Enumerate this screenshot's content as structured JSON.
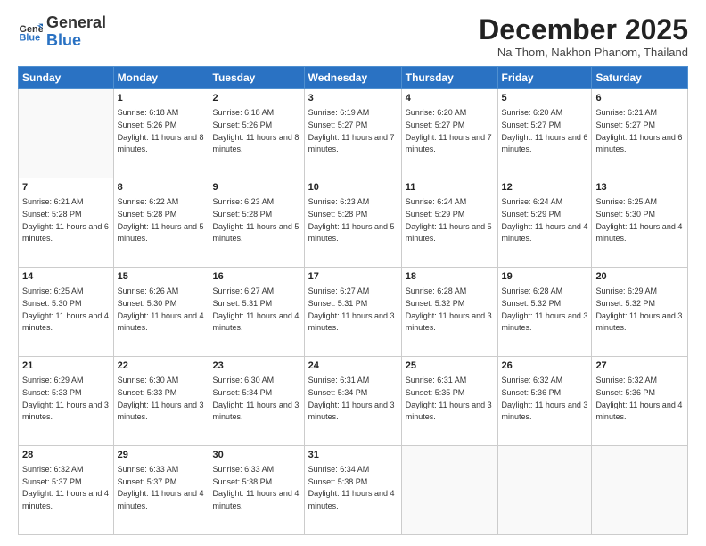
{
  "logo": {
    "text_general": "General",
    "text_blue": "Blue"
  },
  "header": {
    "month": "December 2025",
    "location": "Na Thom, Nakhon Phanom, Thailand"
  },
  "days_of_week": [
    "Sunday",
    "Monday",
    "Tuesday",
    "Wednesday",
    "Thursday",
    "Friday",
    "Saturday"
  ],
  "weeks": [
    [
      {
        "day": "",
        "sunrise": "",
        "sunset": "",
        "daylight": ""
      },
      {
        "day": "1",
        "sunrise": "Sunrise: 6:18 AM",
        "sunset": "Sunset: 5:26 PM",
        "daylight": "Daylight: 11 hours and 8 minutes."
      },
      {
        "day": "2",
        "sunrise": "Sunrise: 6:18 AM",
        "sunset": "Sunset: 5:26 PM",
        "daylight": "Daylight: 11 hours and 8 minutes."
      },
      {
        "day": "3",
        "sunrise": "Sunrise: 6:19 AM",
        "sunset": "Sunset: 5:27 PM",
        "daylight": "Daylight: 11 hours and 7 minutes."
      },
      {
        "day": "4",
        "sunrise": "Sunrise: 6:20 AM",
        "sunset": "Sunset: 5:27 PM",
        "daylight": "Daylight: 11 hours and 7 minutes."
      },
      {
        "day": "5",
        "sunrise": "Sunrise: 6:20 AM",
        "sunset": "Sunset: 5:27 PM",
        "daylight": "Daylight: 11 hours and 6 minutes."
      },
      {
        "day": "6",
        "sunrise": "Sunrise: 6:21 AM",
        "sunset": "Sunset: 5:27 PM",
        "daylight": "Daylight: 11 hours and 6 minutes."
      }
    ],
    [
      {
        "day": "7",
        "sunrise": "Sunrise: 6:21 AM",
        "sunset": "Sunset: 5:28 PM",
        "daylight": "Daylight: 11 hours and 6 minutes."
      },
      {
        "day": "8",
        "sunrise": "Sunrise: 6:22 AM",
        "sunset": "Sunset: 5:28 PM",
        "daylight": "Daylight: 11 hours and 5 minutes."
      },
      {
        "day": "9",
        "sunrise": "Sunrise: 6:23 AM",
        "sunset": "Sunset: 5:28 PM",
        "daylight": "Daylight: 11 hours and 5 minutes."
      },
      {
        "day": "10",
        "sunrise": "Sunrise: 6:23 AM",
        "sunset": "Sunset: 5:28 PM",
        "daylight": "Daylight: 11 hours and 5 minutes."
      },
      {
        "day": "11",
        "sunrise": "Sunrise: 6:24 AM",
        "sunset": "Sunset: 5:29 PM",
        "daylight": "Daylight: 11 hours and 5 minutes."
      },
      {
        "day": "12",
        "sunrise": "Sunrise: 6:24 AM",
        "sunset": "Sunset: 5:29 PM",
        "daylight": "Daylight: 11 hours and 4 minutes."
      },
      {
        "day": "13",
        "sunrise": "Sunrise: 6:25 AM",
        "sunset": "Sunset: 5:30 PM",
        "daylight": "Daylight: 11 hours and 4 minutes."
      }
    ],
    [
      {
        "day": "14",
        "sunrise": "Sunrise: 6:25 AM",
        "sunset": "Sunset: 5:30 PM",
        "daylight": "Daylight: 11 hours and 4 minutes."
      },
      {
        "day": "15",
        "sunrise": "Sunrise: 6:26 AM",
        "sunset": "Sunset: 5:30 PM",
        "daylight": "Daylight: 11 hours and 4 minutes."
      },
      {
        "day": "16",
        "sunrise": "Sunrise: 6:27 AM",
        "sunset": "Sunset: 5:31 PM",
        "daylight": "Daylight: 11 hours and 4 minutes."
      },
      {
        "day": "17",
        "sunrise": "Sunrise: 6:27 AM",
        "sunset": "Sunset: 5:31 PM",
        "daylight": "Daylight: 11 hours and 3 minutes."
      },
      {
        "day": "18",
        "sunrise": "Sunrise: 6:28 AM",
        "sunset": "Sunset: 5:32 PM",
        "daylight": "Daylight: 11 hours and 3 minutes."
      },
      {
        "day": "19",
        "sunrise": "Sunrise: 6:28 AM",
        "sunset": "Sunset: 5:32 PM",
        "daylight": "Daylight: 11 hours and 3 minutes."
      },
      {
        "day": "20",
        "sunrise": "Sunrise: 6:29 AM",
        "sunset": "Sunset: 5:32 PM",
        "daylight": "Daylight: 11 hours and 3 minutes."
      }
    ],
    [
      {
        "day": "21",
        "sunrise": "Sunrise: 6:29 AM",
        "sunset": "Sunset: 5:33 PM",
        "daylight": "Daylight: 11 hours and 3 minutes."
      },
      {
        "day": "22",
        "sunrise": "Sunrise: 6:30 AM",
        "sunset": "Sunset: 5:33 PM",
        "daylight": "Daylight: 11 hours and 3 minutes."
      },
      {
        "day": "23",
        "sunrise": "Sunrise: 6:30 AM",
        "sunset": "Sunset: 5:34 PM",
        "daylight": "Daylight: 11 hours and 3 minutes."
      },
      {
        "day": "24",
        "sunrise": "Sunrise: 6:31 AM",
        "sunset": "Sunset: 5:34 PM",
        "daylight": "Daylight: 11 hours and 3 minutes."
      },
      {
        "day": "25",
        "sunrise": "Sunrise: 6:31 AM",
        "sunset": "Sunset: 5:35 PM",
        "daylight": "Daylight: 11 hours and 3 minutes."
      },
      {
        "day": "26",
        "sunrise": "Sunrise: 6:32 AM",
        "sunset": "Sunset: 5:36 PM",
        "daylight": "Daylight: 11 hours and 3 minutes."
      },
      {
        "day": "27",
        "sunrise": "Sunrise: 6:32 AM",
        "sunset": "Sunset: 5:36 PM",
        "daylight": "Daylight: 11 hours and 4 minutes."
      }
    ],
    [
      {
        "day": "28",
        "sunrise": "Sunrise: 6:32 AM",
        "sunset": "Sunset: 5:37 PM",
        "daylight": "Daylight: 11 hours and 4 minutes."
      },
      {
        "day": "29",
        "sunrise": "Sunrise: 6:33 AM",
        "sunset": "Sunset: 5:37 PM",
        "daylight": "Daylight: 11 hours and 4 minutes."
      },
      {
        "day": "30",
        "sunrise": "Sunrise: 6:33 AM",
        "sunset": "Sunset: 5:38 PM",
        "daylight": "Daylight: 11 hours and 4 minutes."
      },
      {
        "day": "31",
        "sunrise": "Sunrise: 6:34 AM",
        "sunset": "Sunset: 5:38 PM",
        "daylight": "Daylight: 11 hours and 4 minutes."
      },
      {
        "day": "",
        "sunrise": "",
        "sunset": "",
        "daylight": ""
      },
      {
        "day": "",
        "sunrise": "",
        "sunset": "",
        "daylight": ""
      },
      {
        "day": "",
        "sunrise": "",
        "sunset": "",
        "daylight": ""
      }
    ]
  ]
}
